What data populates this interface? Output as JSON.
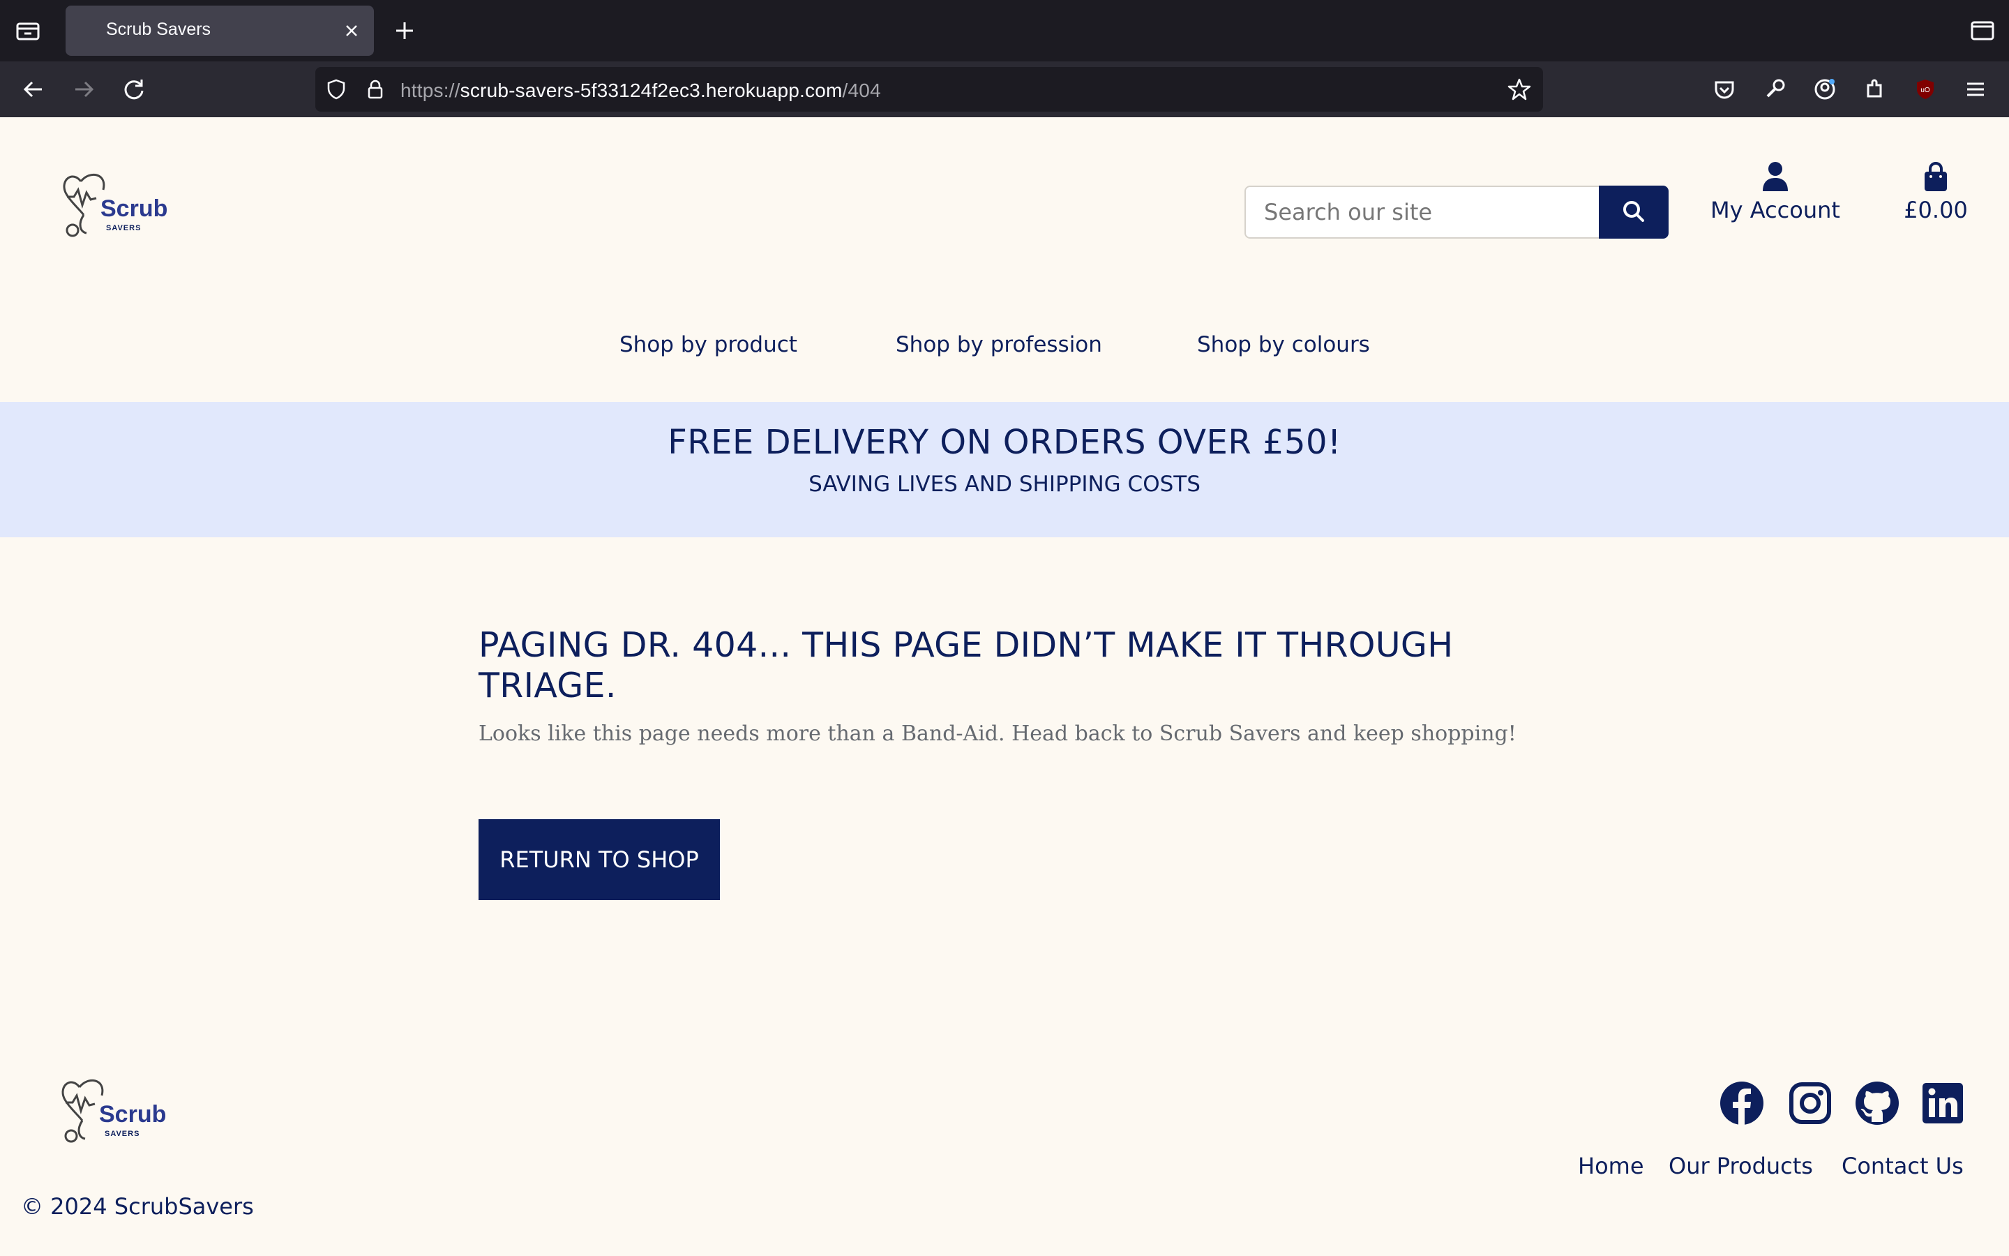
{
  "browser": {
    "tab_title": "Scrub Savers",
    "url_scheme": "https://",
    "url_host": "scrub-savers-5f33124f2ec3.herokuapp.com",
    "url_path": "/404"
  },
  "header": {
    "logo_text": "Scrub",
    "logo_subtext": "SAVERS",
    "search_placeholder": "Search our site",
    "account_label": "My Account",
    "bag_total": "£0.00"
  },
  "nav": {
    "items": [
      "Shop by product",
      "Shop by profession",
      "Shop by colours"
    ]
  },
  "banner": {
    "title": "FREE DELIVERY ON ORDERS OVER £50!",
    "subtitle": "SAVING LIVES AND SHIPPING COSTS"
  },
  "error": {
    "title": "PAGING DR. 404... THIS PAGE DIDN’T MAKE IT THROUGH TRIAGE.",
    "message": "Looks like this page needs more than a Band-Aid. Head back to Scrub Savers and keep shopping!",
    "button": "RETURN TO SHOP"
  },
  "footer": {
    "links": [
      "Home",
      "Our Products",
      "Contact Us"
    ],
    "copyright": "© 2024 ScrubSavers",
    "social": [
      "facebook-icon",
      "instagram-icon",
      "github-icon",
      "linkedin-icon"
    ]
  },
  "colors": {
    "brand_navy": "#0d1f5c",
    "page_bg": "#fdf9f2",
    "banner_bg": "#e1e8fc"
  }
}
